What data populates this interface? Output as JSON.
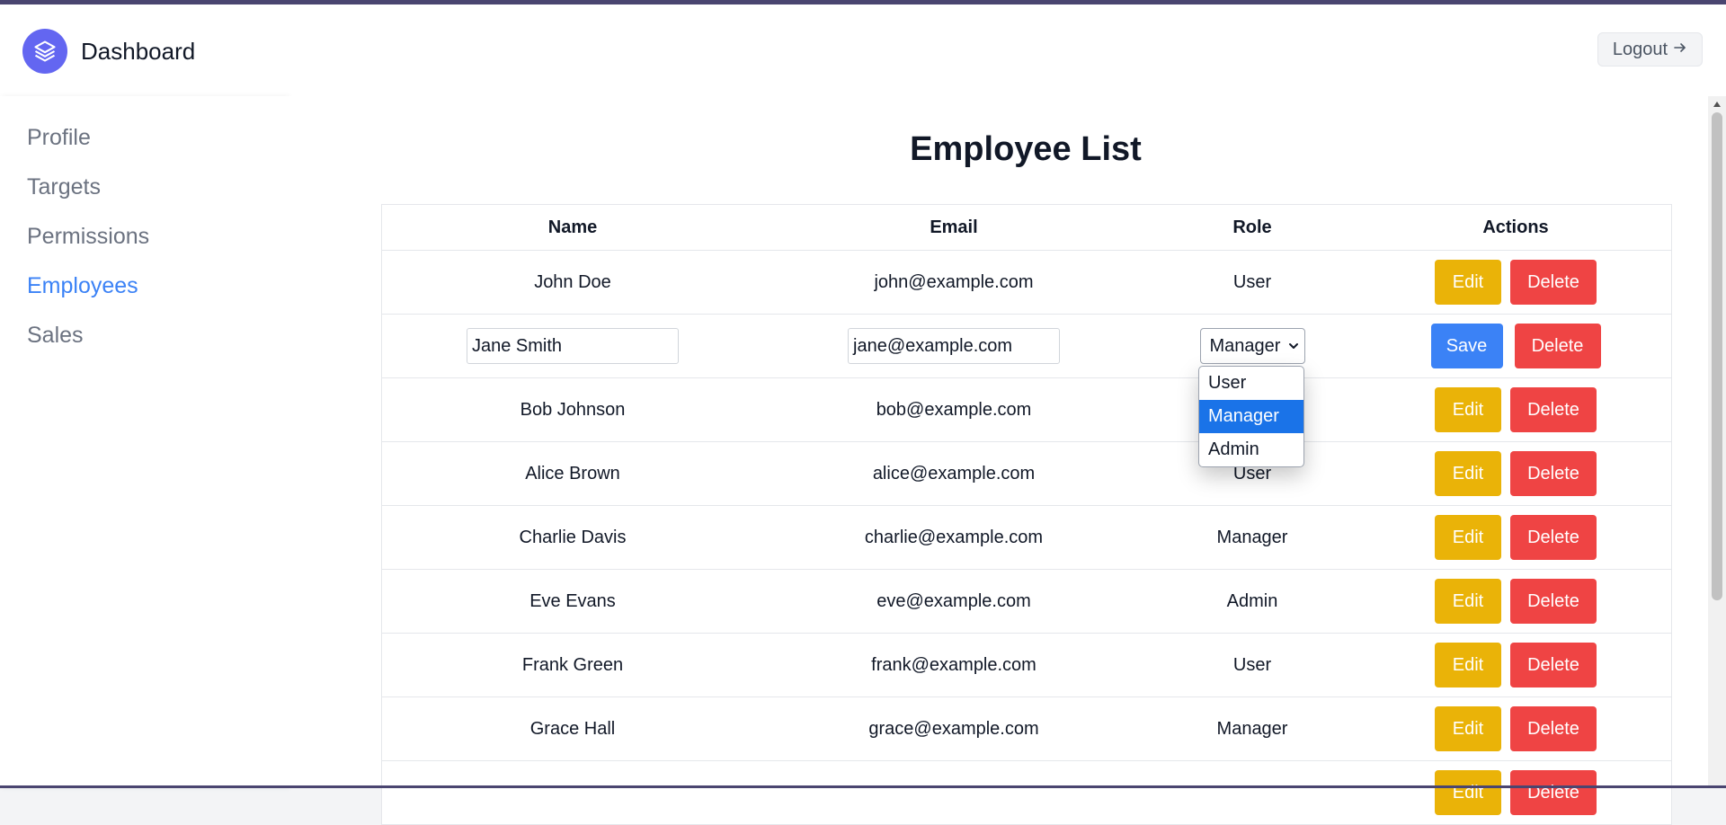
{
  "header": {
    "brand": "Dashboard",
    "logout_label": "Logout",
    "logo_icon": "layers-icon",
    "logout_icon": "arrow-right-icon"
  },
  "sidebar": {
    "items": [
      {
        "label": "Profile",
        "active": false
      },
      {
        "label": "Targets",
        "active": false
      },
      {
        "label": "Permissions",
        "active": false
      },
      {
        "label": "Employees",
        "active": true
      },
      {
        "label": "Sales",
        "active": false
      }
    ]
  },
  "main": {
    "title": "Employee List",
    "columns": [
      "Name",
      "Email",
      "Role",
      "Actions"
    ],
    "edit_label": "Edit",
    "delete_label": "Delete",
    "save_label": "Save",
    "editing_row": {
      "name": "Jane Smith",
      "email": "jane@example.com",
      "role": "Manager"
    },
    "role_options": [
      "User",
      "Manager",
      "Admin"
    ],
    "rows": [
      {
        "name": "John Doe",
        "email": "john@example.com",
        "role": "User"
      },
      {
        "name": "Bob Johnson",
        "email": "bob@example.com",
        "role": ""
      },
      {
        "name": "Alice Brown",
        "email": "alice@example.com",
        "role": "User"
      },
      {
        "name": "Charlie Davis",
        "email": "charlie@example.com",
        "role": "Manager"
      },
      {
        "name": "Eve Evans",
        "email": "eve@example.com",
        "role": "Admin"
      },
      {
        "name": "Frank Green",
        "email": "frank@example.com",
        "role": "User"
      },
      {
        "name": "Grace Hall",
        "email": "grace@example.com",
        "role": "Manager"
      }
    ]
  },
  "colors": {
    "accent": "#3b82f6",
    "edit": "#eab308",
    "delete": "#ef4444",
    "logo": "#6366f1"
  }
}
